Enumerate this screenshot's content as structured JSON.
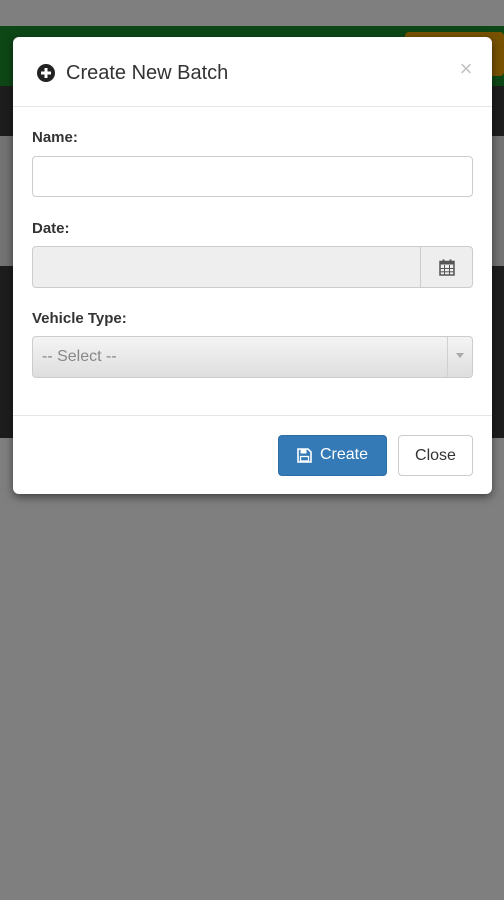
{
  "modal": {
    "title": "Create New Batch",
    "close_glyph": "×",
    "icons": {
      "title": "plus-circle-icon",
      "close": "close-icon",
      "date_addon": "calendar-icon",
      "create_button": "save-icon",
      "select_caret": "chevron-down-icon"
    }
  },
  "form": {
    "name_label": "Name:",
    "name_value": "",
    "date_label": "Date:",
    "date_value": "",
    "vehicle_type_label": "Vehicle Type:",
    "vehicle_type_selected": "-- Select --"
  },
  "footer": {
    "create_label": "Create",
    "close_label": "Close"
  },
  "colors": {
    "header_green": "#1b8f2c",
    "primary_button": "#337ab7",
    "overlay": "rgba(0,0,0,0.5)"
  }
}
